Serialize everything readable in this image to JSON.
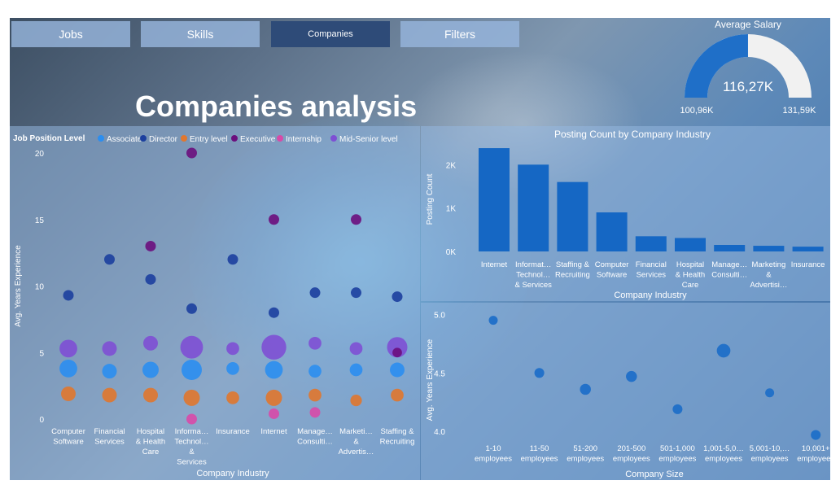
{
  "nav": {
    "tabs": [
      {
        "label": "Jobs"
      },
      {
        "label": "Skills"
      },
      {
        "label": "Companies"
      },
      {
        "label": "Filters"
      }
    ]
  },
  "page": {
    "title": "Companies analysis"
  },
  "gauge": {
    "title": "Average Salary",
    "value_label": "116,27K",
    "min_label": "100,96K",
    "max_label": "131,59K",
    "min": 100.96,
    "max": 131.59,
    "value": 116.27,
    "fill_color": "#1f6fc8",
    "track_color": "#f1f1f1"
  },
  "colors": {
    "Associate": "#2b8ef0",
    "Director": "#1c3f9e",
    "Entry level": "#e0772e",
    "Executive": "#6b0e7d",
    "Internship": "#d84aa8",
    "Mid-Senior level": "#7e4fd4",
    "bar": "#1567c4",
    "dot": "#1f6fc8"
  },
  "chart_data": [
    {
      "type": "scatter",
      "legend_title": "Job Position Level",
      "legend": [
        "Associate",
        "Director",
        "Entry level",
        "Executive",
        "Internship",
        "Mid-Senior level"
      ],
      "legend_position": "top-left",
      "xlabel": "Company Industry",
      "ylabel": "Avg. Years Experience",
      "ylim": [
        0,
        20
      ],
      "yticks": [
        0,
        5,
        10,
        15,
        20
      ],
      "categories": [
        "Computer Software",
        "Financial Services",
        "Hospital & Health Care",
        "Information Technology & Services",
        "Insurance",
        "Internet",
        "Management Consulting",
        "Marketing & Advertising",
        "Staffing & Recruiting"
      ],
      "category_tick_lines": [
        [
          "Computer",
          "Software"
        ],
        [
          "Financial",
          "Services"
        ],
        [
          "Hospital",
          "& Health",
          "Care"
        ],
        [
          "Informa…",
          "Technol…",
          "&",
          "Services"
        ],
        [
          "Insurance"
        ],
        [
          "Internet"
        ],
        [
          "Manage…",
          "Consulti…"
        ],
        [
          "Marketi…",
          "&",
          "Advertis…"
        ],
        [
          "Staffing &",
          "Recruiting"
        ]
      ],
      "points": [
        {
          "cat": 0,
          "level": "Director",
          "y": 9.3,
          "size": 1
        },
        {
          "cat": 0,
          "level": "Mid-Senior level",
          "y": 5.3,
          "size": 3
        },
        {
          "cat": 0,
          "level": "Associate",
          "y": 3.8,
          "size": 3
        },
        {
          "cat": 0,
          "level": "Entry level",
          "y": 1.9,
          "size": 2
        },
        {
          "cat": 1,
          "level": "Director",
          "y": 12.0,
          "size": 1
        },
        {
          "cat": 1,
          "level": "Mid-Senior level",
          "y": 5.3,
          "size": 2
        },
        {
          "cat": 1,
          "level": "Associate",
          "y": 3.6,
          "size": 2
        },
        {
          "cat": 1,
          "level": "Entry level",
          "y": 1.8,
          "size": 2
        },
        {
          "cat": 2,
          "level": "Executive",
          "y": 13.0,
          "size": 1
        },
        {
          "cat": 2,
          "level": "Director",
          "y": 10.5,
          "size": 1
        },
        {
          "cat": 2,
          "level": "Mid-Senior level",
          "y": 5.7,
          "size": 2
        },
        {
          "cat": 2,
          "level": "Associate",
          "y": 3.7,
          "size": 2.5
        },
        {
          "cat": 2,
          "level": "Entry level",
          "y": 1.8,
          "size": 2
        },
        {
          "cat": 3,
          "level": "Executive",
          "y": 20.0,
          "size": 1
        },
        {
          "cat": 3,
          "level": "Director",
          "y": 8.3,
          "size": 1
        },
        {
          "cat": 3,
          "level": "Mid-Senior level",
          "y": 5.4,
          "size": 5
        },
        {
          "cat": 3,
          "level": "Associate",
          "y": 3.7,
          "size": 4
        },
        {
          "cat": 3,
          "level": "Entry level",
          "y": 1.6,
          "size": 2.5
        },
        {
          "cat": 3,
          "level": "Internship",
          "y": 0.0,
          "size": 1
        },
        {
          "cat": 4,
          "level": "Director",
          "y": 12.0,
          "size": 1
        },
        {
          "cat": 4,
          "level": "Mid-Senior level",
          "y": 5.3,
          "size": 1.5
        },
        {
          "cat": 4,
          "level": "Associate",
          "y": 3.8,
          "size": 1.5
        },
        {
          "cat": 4,
          "level": "Entry level",
          "y": 1.6,
          "size": 1.5
        },
        {
          "cat": 5,
          "level": "Executive",
          "y": 15.0,
          "size": 1
        },
        {
          "cat": 5,
          "level": "Director",
          "y": 8.0,
          "size": 1
        },
        {
          "cat": 5,
          "level": "Mid-Senior level",
          "y": 5.4,
          "size": 6
        },
        {
          "cat": 5,
          "level": "Associate",
          "y": 3.7,
          "size": 3
        },
        {
          "cat": 5,
          "level": "Entry level",
          "y": 1.6,
          "size": 2.5
        },
        {
          "cat": 5,
          "level": "Internship",
          "y": 0.4,
          "size": 1
        },
        {
          "cat": 6,
          "level": "Director",
          "y": 9.5,
          "size": 1
        },
        {
          "cat": 6,
          "level": "Mid-Senior level",
          "y": 5.7,
          "size": 1.5
        },
        {
          "cat": 6,
          "level": "Associate",
          "y": 3.6,
          "size": 1.5
        },
        {
          "cat": 6,
          "level": "Entry level",
          "y": 1.8,
          "size": 1.5
        },
        {
          "cat": 6,
          "level": "Internship",
          "y": 0.5,
          "size": 1
        },
        {
          "cat": 7,
          "level": "Executive",
          "y": 15.0,
          "size": 1
        },
        {
          "cat": 7,
          "level": "Director",
          "y": 9.5,
          "size": 1
        },
        {
          "cat": 7,
          "level": "Mid-Senior level",
          "y": 5.3,
          "size": 1.5
        },
        {
          "cat": 7,
          "level": "Associate",
          "y": 3.7,
          "size": 1.5
        },
        {
          "cat": 7,
          "level": "Entry level",
          "y": 1.4,
          "size": 1.2
        },
        {
          "cat": 8,
          "level": "Director",
          "y": 9.2,
          "size": 1
        },
        {
          "cat": 8,
          "level": "Mid-Senior level",
          "y": 5.4,
          "size": 4
        },
        {
          "cat": 8,
          "level": "Executive",
          "y": 5.0,
          "size": 0.8
        },
        {
          "cat": 8,
          "level": "Associate",
          "y": 3.7,
          "size": 2
        },
        {
          "cat": 8,
          "level": "Entry level",
          "y": 1.8,
          "size": 1.5
        }
      ]
    },
    {
      "type": "bar",
      "title": "Posting Count by Company Industry",
      "xlabel": "Company Industry",
      "ylabel": "Posting Count",
      "ylim": [
        0,
        2400
      ],
      "yticks": [
        0,
        1000,
        2000
      ],
      "ytick_labels": [
        "0K",
        "1K",
        "2K"
      ],
      "categories": [
        "Internet",
        "Information Technology & Services",
        "Staffing & Recruiting",
        "Computer Software",
        "Financial Services",
        "Hospital & Health Care",
        "Management Consulting",
        "Marketing & Advertising",
        "Insurance"
      ],
      "category_tick_lines": [
        [
          "Internet"
        ],
        [
          "Informat…",
          "Technol…",
          "& Services"
        ],
        [
          "Staffing &",
          "Recruiting"
        ],
        [
          "Computer",
          "Software"
        ],
        [
          "Financial",
          "Services"
        ],
        [
          "Hospital",
          "& Health",
          "Care"
        ],
        [
          "Manage…",
          "Consulti…"
        ],
        [
          "Marketing",
          "&",
          "Advertisi…"
        ],
        [
          "Insurance"
        ]
      ],
      "values": [
        2380,
        2000,
        1600,
        900,
        350,
        310,
        150,
        130,
        110
      ]
    },
    {
      "type": "scatter",
      "xlabel": "Company Size",
      "ylabel": "Avg. Years Experience",
      "ylim": [
        3.8,
        5.1
      ],
      "yticks": [
        4.0,
        4.5,
        5.0
      ],
      "ytick_labels": [
        "4.0",
        "4.5",
        "5.0"
      ],
      "categories": [
        "1-10 employees",
        "11-50 employees",
        "51-200 employees",
        "201-500 employees",
        "501-1,000 employees",
        "1,001-5,000 employees",
        "5,001-10,000 employees",
        "10,001+ employees"
      ],
      "category_tick_lines": [
        [
          "1-10",
          "employees"
        ],
        [
          "11-50",
          "employees"
        ],
        [
          "51-200",
          "employees"
        ],
        [
          "201-500",
          "employees"
        ],
        [
          "501-1,000",
          "employees"
        ],
        [
          "1,001-5,0…",
          "employees"
        ],
        [
          "5,001-10,…",
          "employees"
        ],
        [
          "10,001+",
          "employees"
        ]
      ],
      "points": [
        {
          "cat": 0,
          "y": 4.95,
          "size": 1
        },
        {
          "cat": 1,
          "y": 4.5,
          "size": 1.2
        },
        {
          "cat": 2,
          "y": 4.36,
          "size": 1.5
        },
        {
          "cat": 3,
          "y": 4.47,
          "size": 1.5
        },
        {
          "cat": 4,
          "y": 4.19,
          "size": 1.2
        },
        {
          "cat": 5,
          "y": 4.69,
          "size": 2.3
        },
        {
          "cat": 6,
          "y": 4.33,
          "size": 1
        },
        {
          "cat": 7,
          "y": 3.97,
          "size": 1.2
        }
      ]
    }
  ]
}
